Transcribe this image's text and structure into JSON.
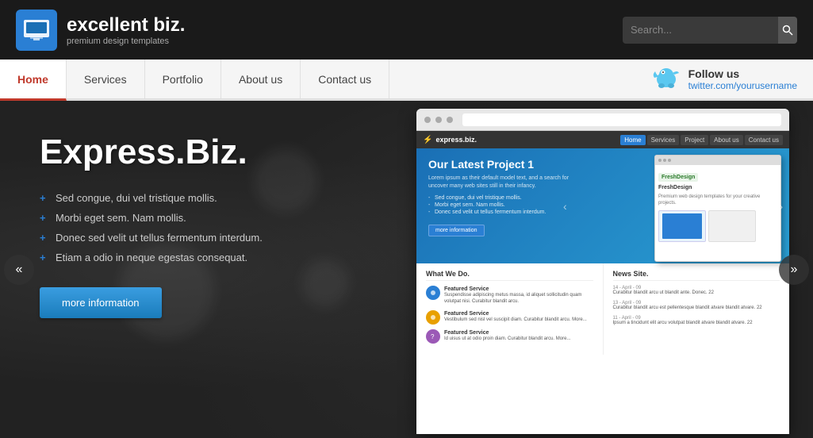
{
  "header": {
    "logo_title": "excellent biz.",
    "logo_subtitle": "premium design templates",
    "search_placeholder": "Search..."
  },
  "nav": {
    "items": [
      {
        "label": "Home",
        "active": true
      },
      {
        "label": "Services",
        "active": false
      },
      {
        "label": "Portfolio",
        "active": false
      },
      {
        "label": "About us",
        "active": false
      },
      {
        "label": "Contact us",
        "active": false
      }
    ],
    "follow_label": "Follow us",
    "twitter_handle": "twitter.com/yourusername"
  },
  "hero": {
    "title": "Express.Biz.",
    "list_items": [
      "Sed congue, dui vel tristique mollis.",
      "Morbi eget sem. Nam mollis.",
      "Donec sed velit ut tellus fermentum interdum.",
      "Etiam a odio in neque egestas consequat."
    ],
    "more_info_btn": "more information"
  },
  "inner_site": {
    "logo": "express.biz.",
    "nav_items": [
      "Home",
      "Services",
      "Project",
      "About us",
      "Contact us"
    ],
    "hero_title": "Our Latest Project 1",
    "hero_text": "Lorem ipsum as their default model text, and a search for uncover many web sites still in their infancy.",
    "hero_list": [
      "Sed congue, dui vel tristique mollis.",
      "Morbi eget sem. Nam mollis.",
      "Donec sed velit ut tellus fermentum interdum."
    ],
    "hero_btn": "more information",
    "fresh_design": "FreshDesign",
    "what_we_do_title": "What We Do.",
    "news_title": "News Site.",
    "services": [
      {
        "title": "Featured Service",
        "text": "Suspendisse adipiscing metus massa, id aliquet sollicitudin quam volutpat nisi. Curabitur blandit arcu."
      },
      {
        "title": "Featured Service",
        "text": "Vestibulum sed nisl vel suscipit diam. Curabitur blandit arcu. More..."
      },
      {
        "title": "Featured Service",
        "text": "Id uisus ut at odio proin diam. Curabitur blandit arcu. More..."
      }
    ],
    "news_items": [
      {
        "date": "14 - April - 09",
        "text": "Curabitur blandit arcu ut blandit ante. Donec. 22"
      },
      {
        "date": "13 - April - 09",
        "text": "Curabitur blandit arcu est pellentesque blandit atvare blandit atvare. 22"
      },
      {
        "date": "11 - April - 09",
        "text": "Ipsum a tincidunt elit arcu volutpat blandit atvare blandit atvare. 22"
      }
    ]
  },
  "controls": {
    "prev_label": "«",
    "next_label": "»"
  }
}
